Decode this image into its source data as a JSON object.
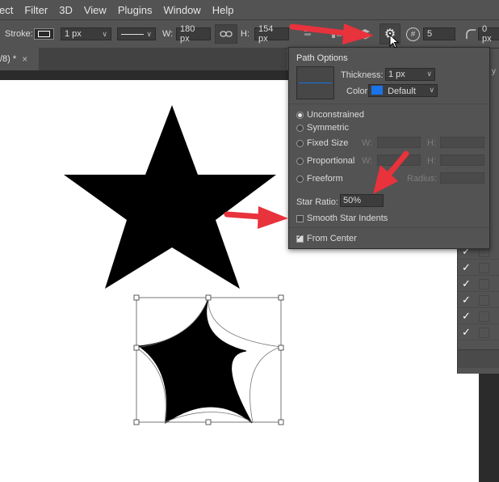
{
  "menu": [
    "ect",
    "Filter",
    "3D",
    "View",
    "Plugins",
    "Window",
    "Help"
  ],
  "options": {
    "stroke_label": "Stroke:",
    "stroke_width": "1 px",
    "width_label": "W:",
    "width_value": "180 px",
    "height_label": "H:",
    "height_value": "154 px",
    "points_value": "5",
    "radius_value": "0 px"
  },
  "tab": {
    "label": "/8) *",
    "close": "×"
  },
  "popup": {
    "title": "Path Options",
    "thickness_label": "Thickness:",
    "thickness_value": "1 px",
    "color_label": "Color:",
    "color_value": "Default",
    "color_swatch": "#1a73e8",
    "opt_unconstrained": "Unconstrained",
    "opt_symmetric": "Symmetric",
    "opt_fixed_size": "Fixed Size",
    "opt_proportional": "Proportional",
    "opt_freeform": "Freeform",
    "w_label": "W:",
    "h_label": "H:",
    "radius_label": "Radius:",
    "star_ratio_label": "Star Ratio:",
    "star_ratio_value": "50%",
    "smooth_indents_label": "Smooth Star Indents",
    "from_center_label": "From Center",
    "selected_mode": "Unconstrained",
    "smooth_indents_checked": false,
    "from_center_checked": true
  },
  "annotation_color": "#e8323c"
}
